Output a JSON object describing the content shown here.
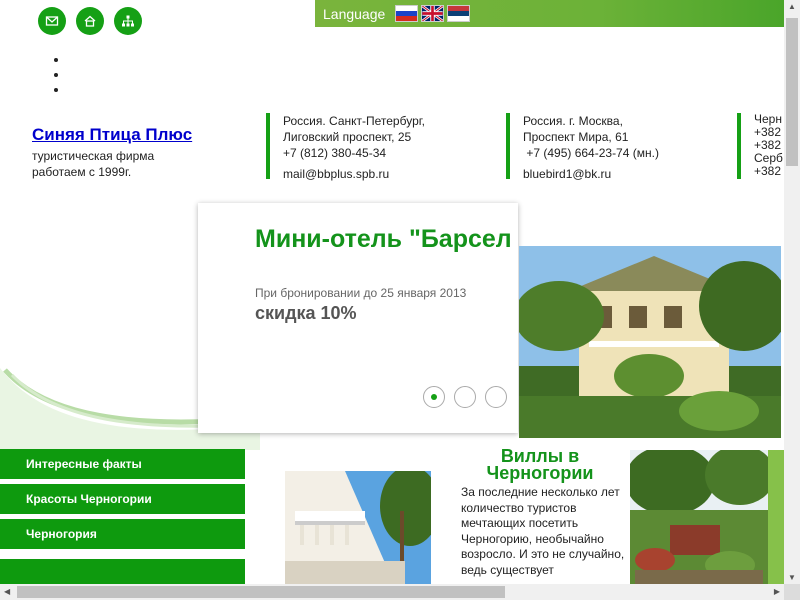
{
  "top_icons": [
    "mail-icon",
    "home-icon",
    "sitemap-icon"
  ],
  "language": {
    "label": "Language",
    "flags": [
      "ru",
      "uk",
      "rs"
    ]
  },
  "brand": {
    "title": "Синяя Птица Плюс",
    "line1": "туристическая фирма",
    "line2": "работаем с 1999г."
  },
  "contacts": [
    {
      "line1": "Россия. Санкт-Петербург,",
      "line2": "Лиговский проспект, 25",
      "phone": "+7 (812) 380-45-34",
      "email": "mail@bbplus.spb.ru"
    },
    {
      "line1": "Россия. г. Москва,",
      "line2": "Проспект Мира, 61",
      "phone": " +7 (495) 664-23-74 (мн.)",
      "email": "bluebird1@bk.ru"
    },
    {
      "line1": "Черн",
      "line2": "+382",
      "line3": "+382",
      "line4": "Серб",
      "line5": "+382"
    }
  ],
  "slider": {
    "title": "Мини-отель \"Барсел",
    "note": "При бронировании до 25 января 2013",
    "discount": "скидка 10%",
    "active_index": 0,
    "dots": 3
  },
  "menu": [
    "Интересные факты",
    "Красоты Черногории",
    "Черногория",
    ""
  ],
  "villas": {
    "title": "Виллы в Черногории",
    "text": "За последние несколько лет количество туристов мечтающих посетить Черногорию, необычайно возросло. И это не случайно, ведь существует"
  },
  "colors": {
    "accent": "#15a015",
    "title_green": "#14931b",
    "lang_bar": "#6cb238"
  }
}
